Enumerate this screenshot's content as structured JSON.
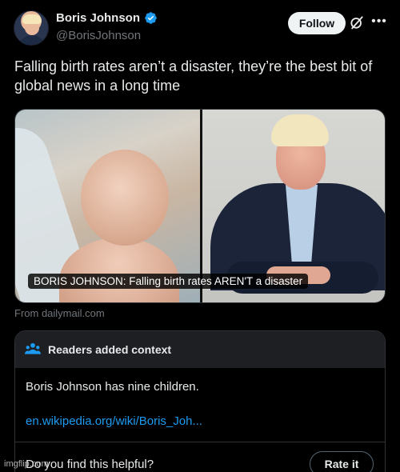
{
  "author": {
    "display_name": "Boris Johnson",
    "handle": "@BorisJohnson",
    "verified": true
  },
  "header": {
    "follow_label": "Follow",
    "grok_icon": "grok-icon",
    "more_icon": "more-icon"
  },
  "tweet": {
    "text": "Falling birth rates aren’t a disaster, they’re the best bit of global news in a long time"
  },
  "media": {
    "caption": "BORIS JOHNSON: Falling birth rates AREN'T a disaster",
    "source": "From dailymail.com"
  },
  "context": {
    "title": "Readers added context",
    "body": "Boris Johnson has nine children.",
    "link": "en.wikipedia.org/wiki/Boris_Joh...",
    "helpful_question": "Do you find this helpful?",
    "rate_label": "Rate it"
  },
  "watermark": "imgflip.com",
  "colors": {
    "background": "#000000",
    "link": "#1d9bf0",
    "verified": "#1d9bf0",
    "muted": "#71767b"
  }
}
